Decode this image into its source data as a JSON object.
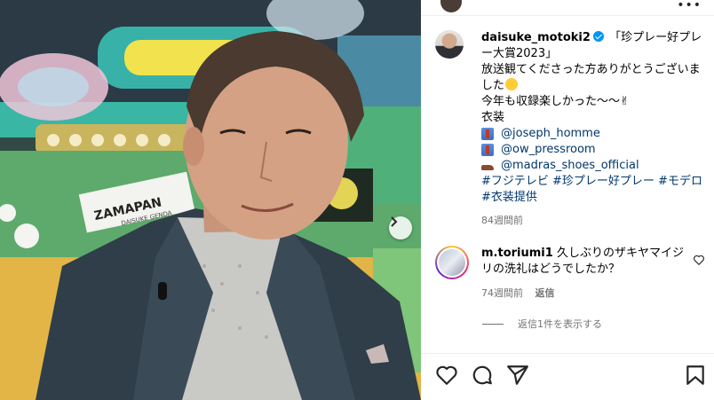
{
  "post": {
    "username": "daisuke_motoki2",
    "caption_title": "「珍プレー好プレー大賞2023」",
    "caption_line2": "放送観てくださった方ありがとうございました",
    "caption_line3": "今年も収録楽しかった〜〜✌",
    "caption_line4": "衣装",
    "mentions": [
      {
        "icon": "shirt-icon",
        "text": "@joseph_homme"
      },
      {
        "icon": "shirt-icon",
        "text": "@ow_pressroom"
      },
      {
        "icon": "shoe-icon",
        "text": "@madras_shoes_official"
      }
    ],
    "hashtags": "#フジテレビ #珍プレー好プレー #モデロ #衣装提供",
    "time_ago": "84週間前"
  },
  "comment": {
    "username": "m.toriumi1",
    "text": "久しぶりのザキヤマイジリの洗礼はどうでしたか？",
    "time_ago": "74週間前",
    "reply_label": "返信"
  },
  "view_replies": "返信1件を表示する",
  "photo": {
    "banner_text": "ZAMAPAN",
    "banner_sub": "DAISUKE GENDA"
  },
  "icons": {
    "next": "chevron-right-icon",
    "like": "heart-icon",
    "comment": "comment-icon",
    "share": "share-icon",
    "save": "bookmark-icon",
    "more": "more-icon"
  },
  "colors": {
    "link": "#00376b",
    "verified": "#0095f6",
    "meta": "#737373"
  }
}
